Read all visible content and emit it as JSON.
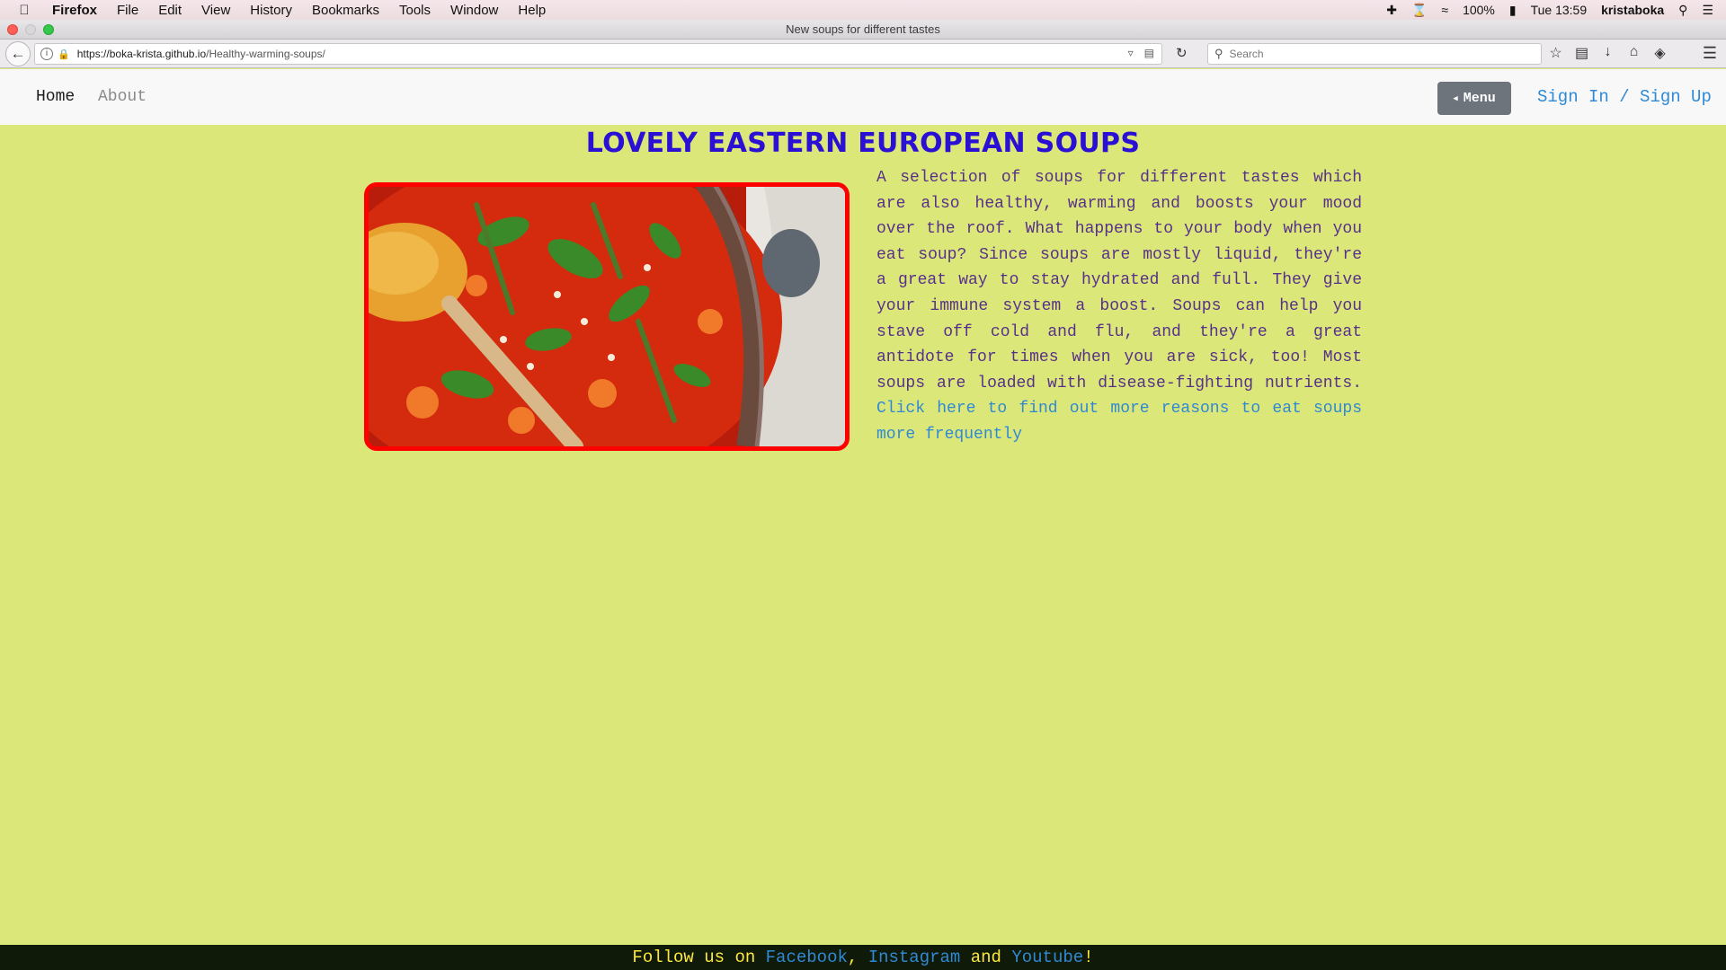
{
  "menubar": {
    "app": "Firefox",
    "items": [
      "File",
      "Edit",
      "View",
      "History",
      "Bookmarks",
      "Tools",
      "Window",
      "Help"
    ],
    "battery": "100%",
    "clock": "Tue 13:59",
    "user": "kristaboka"
  },
  "window": {
    "title": "New soups for different tastes"
  },
  "toolbar": {
    "url_host": "https://boka-krista.github.io",
    "url_path": "/Healthy-warming-soups/",
    "search_placeholder": "Search"
  },
  "nav": {
    "home": "Home",
    "about": "About",
    "menu_button": "Menu",
    "sign_in": "Sign In",
    "separator": "/",
    "sign_up": "Sign Up"
  },
  "main": {
    "title": "LOVELY EASTERN EUROPEAN SOUPS",
    "paragraph": "A selection of soups for different tastes which are also healthy, warming and boosts your mood over the roof. What happens to your body when you eat soup? Since soups are mostly liquid, they're a great way to stay hydrated and full. They give your immune system a boost. Soups can help you stave off cold and flu, and they're a great antidote for times when you are sick, too! Most soups are loaded with disease-fighting nutrients.",
    "link_text": "Click here to find out more reasons to eat soups more frequently"
  },
  "footer": {
    "prefix": "Follow us on",
    "facebook": "Facebook",
    "comma": ",",
    "instagram": "Instagram",
    "and": "and",
    "youtube": "Youtube",
    "suffix": "!"
  },
  "colors": {
    "background": "#dce779",
    "title": "#2a0fd4",
    "link": "#2f89d4",
    "image_border": "#ff0000",
    "footer_bg": "#0f1a09",
    "footer_text": "#ffe83a"
  }
}
